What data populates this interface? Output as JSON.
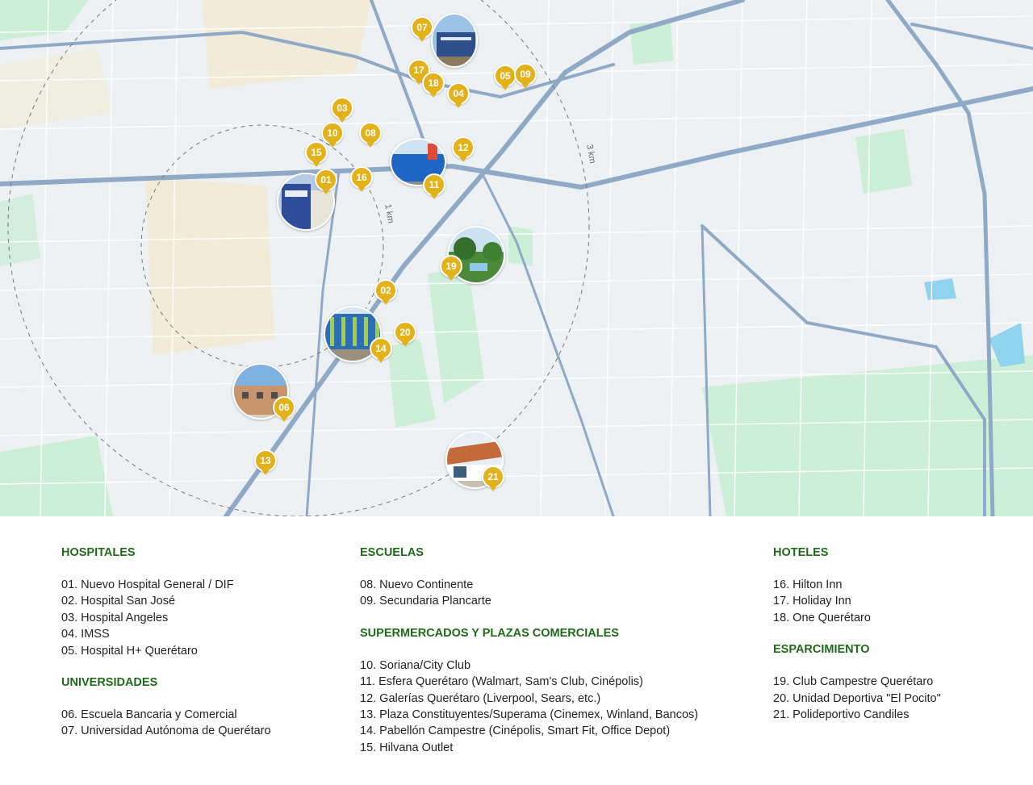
{
  "map": {
    "accent_color": "#e3b21b",
    "road_color": "#8faac7",
    "park_color": "#cdeed7",
    "land_color": "#f1ebd8",
    "water_color": "#8fd3ee",
    "ring_labels": {
      "inner": "1 km",
      "outer": "3 km"
    },
    "markers": [
      "01",
      "02",
      "03",
      "04",
      "05",
      "06",
      "07",
      "08",
      "09",
      "10",
      "11",
      "12",
      "13",
      "14",
      "15",
      "16",
      "17",
      "18",
      "19",
      "20",
      "21"
    ]
  },
  "legend": {
    "hospitales": {
      "title": "HOSPITALES",
      "items": [
        "01. Nuevo Hospital General / DIF",
        "02. Hospital San José",
        "03. Hospital Angeles",
        "04. IMSS",
        "05. Hospital H+ Querétaro"
      ]
    },
    "universidades": {
      "title": "UNIVERSIDADES",
      "items": [
        "06. Escuela Bancaria y Comercial",
        "07. Universidad Autónoma de Querétaro"
      ]
    },
    "escuelas": {
      "title": "ESCUELAS",
      "items": [
        "08. Nuevo Continente",
        "09. Secundaria Plancarte"
      ]
    },
    "supermercados": {
      "title": "SUPERMERCADOS Y PLAZAS COMERCIALES",
      "items": [
        "10. Soriana/City Club",
        "11. Esfera Querétaro (Walmart, Sam's Club, Cinépolis)",
        "12. Galerías Querétaro (Liverpool, Sears, etc.)",
        "13. Plaza Constituyentes/Superama (Cinemex, Winland, Bancos)",
        "14. Pabellón Campestre (Cinépolis, Smart Fit, Office Depot)",
        "15. Hilvana Outlet"
      ]
    },
    "hoteles": {
      "title": "HOTELES",
      "items": [
        "16. Hilton Inn",
        "17. Holiday Inn",
        "18. One Querétaro"
      ]
    },
    "esparcimiento": {
      "title": "ESPARCIMIENTO",
      "items": [
        "19. Club Campestre Querétaro",
        "20. Unidad Deportiva \"El Pocito\"",
        "21. Polideportivo Candiles"
      ]
    }
  }
}
